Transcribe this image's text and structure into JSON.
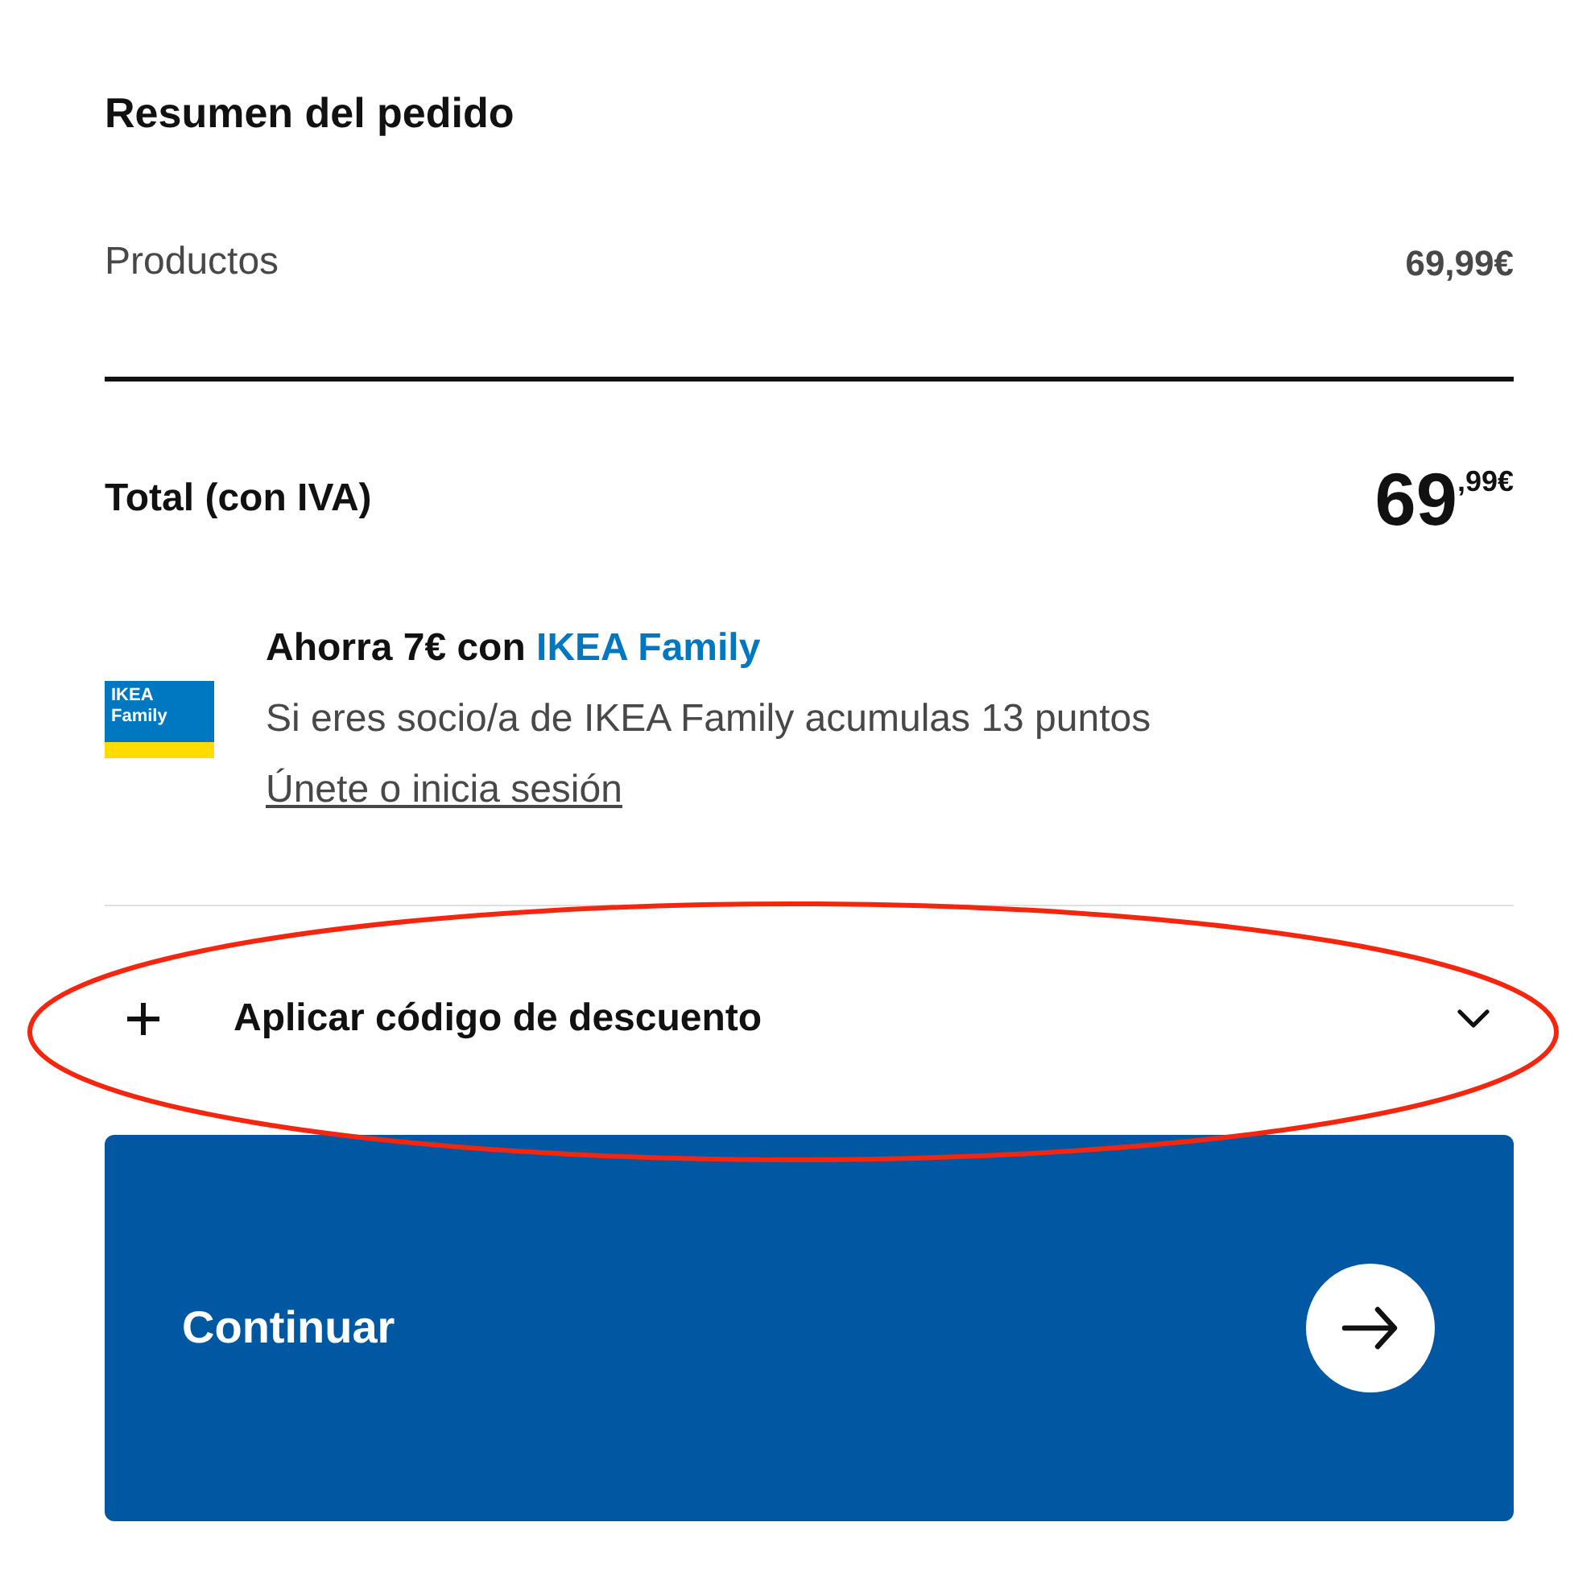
{
  "title": "Resumen del pedido",
  "lines": [
    {
      "label": "Productos",
      "amount": "69,99€"
    }
  ],
  "total": {
    "label": "Total (con IVA)",
    "integer": "69",
    "decimals": ",99€"
  },
  "family_offer": {
    "logo_lines": [
      "IKEA",
      "Family"
    ],
    "heading": "Ahorra 7€ con",
    "brand_link": "IKEA Family",
    "description": "Si eres socio/a de IKEA Family acumulas 13 puntos",
    "link": "Únete o inicia sesión"
  },
  "discount": {
    "label": "Aplicar código de descuento",
    "expanded": false,
    "highlighted": true
  },
  "continue_button": {
    "label": "Continuar"
  }
}
